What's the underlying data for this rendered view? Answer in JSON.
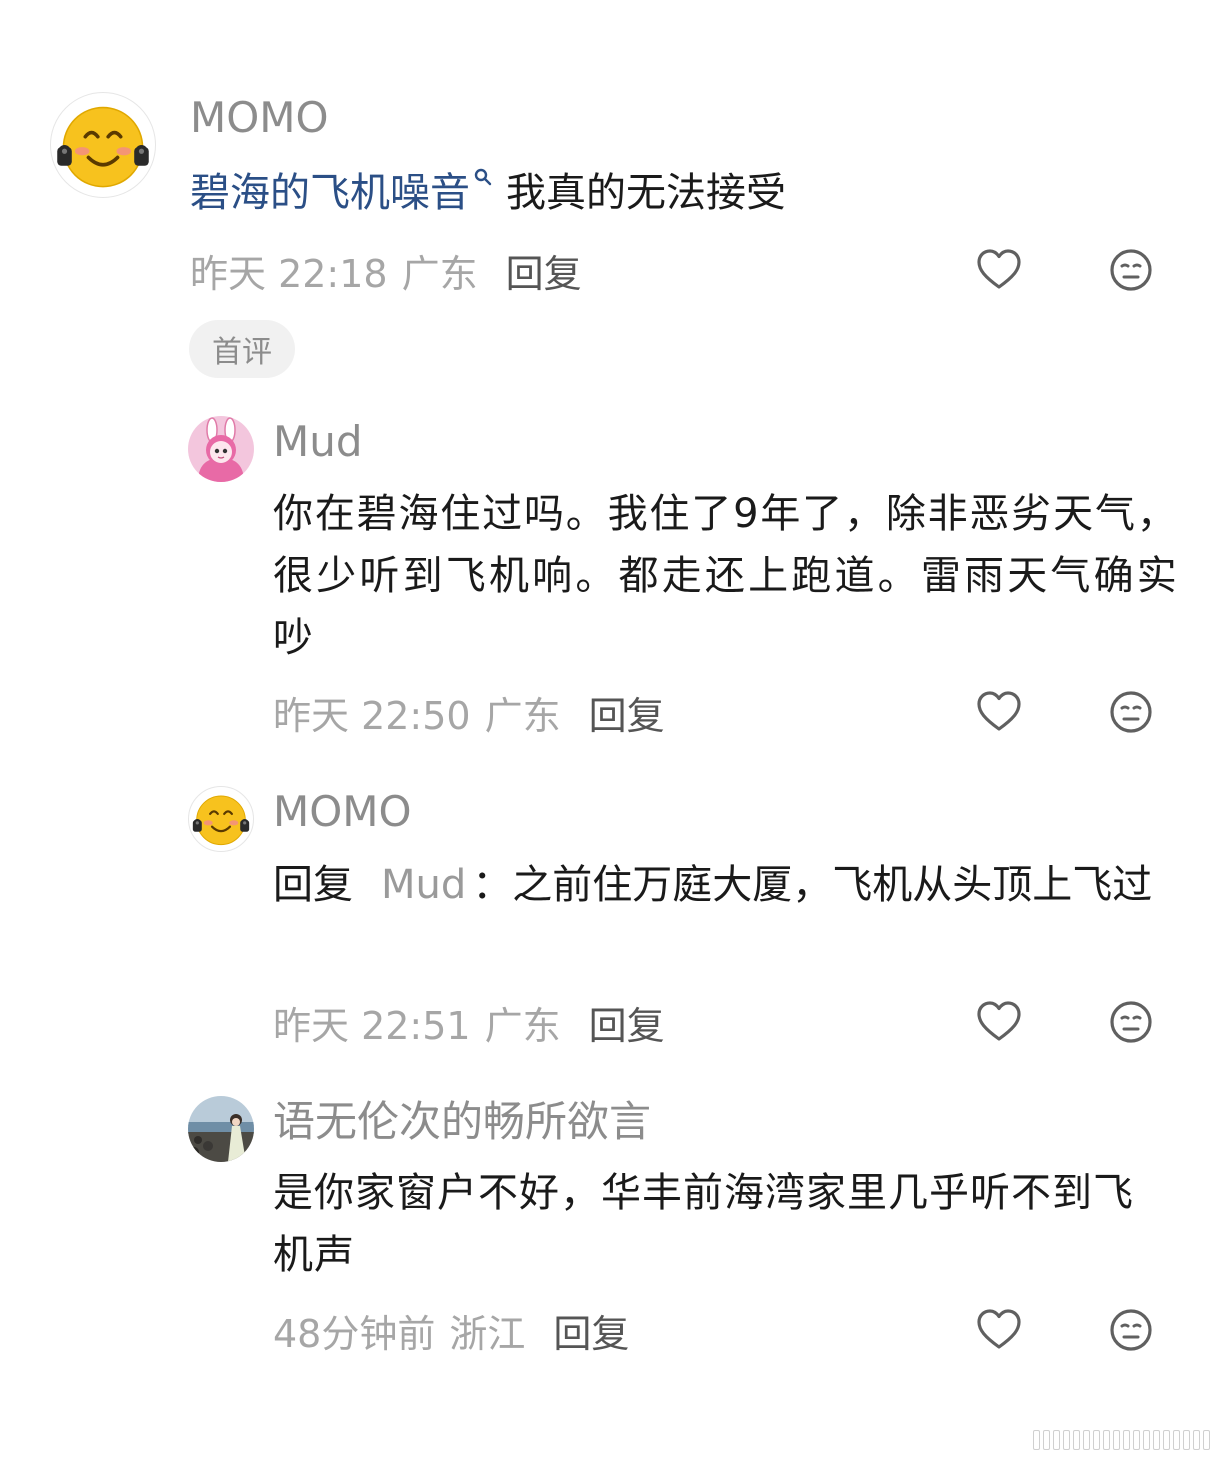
{
  "comment": {
    "username": "MOMO",
    "text_link": "碧海的飞机噪音",
    "search_hint_icon": "search-icon",
    "text_rest": "我真的无法接受",
    "time": "昨天 22:18",
    "location": "广东",
    "reply_label": "回复",
    "tag": "首评",
    "like_icon": "heart-outline-icon",
    "dislike_icon": "neutral-face-icon"
  },
  "replies": [
    {
      "username": "Mud",
      "text": "你在碧海住过吗。我住了9年了，除非恶劣天气，很少听到飞机响。都走还上跑道。雷雨天气确实吵",
      "time": "昨天 22:50",
      "location": "广东",
      "reply_label": "回复"
    },
    {
      "username": "MOMO",
      "reply_prefix": "回复",
      "reply_target": "Mud",
      "text": "：之前住万庭大厦，飞机从头顶上飞过",
      "time": "昨天 22:51",
      "location": "广东",
      "reply_label": "回复"
    },
    {
      "username": "语无伦次的畅所欲言",
      "text": "是你家窗户不好，华丰前海湾家里几乎听不到飞机声",
      "time": "48分钟前",
      "location": "浙江",
      "reply_label": "回复"
    }
  ],
  "colors": {
    "link": "#2b4f86",
    "username": "#8c8c8c",
    "meta": "#a6a6a6",
    "emoji_face": "#f7c21e",
    "pink_avatar": "#f3c6dd"
  }
}
